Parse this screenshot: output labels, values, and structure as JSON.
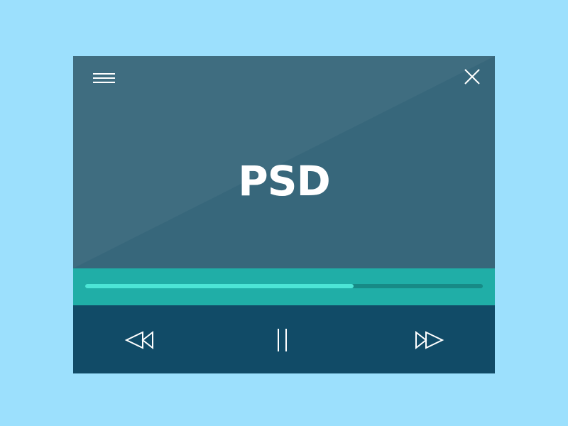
{
  "player": {
    "title": "PSD",
    "progress_fraction": 0.675
  },
  "icons": {
    "menu": "hamburger-menu-icon",
    "close": "close-icon",
    "rewind": "rewind-icon",
    "pause": "pause-icon",
    "fast_forward": "fast-forward-icon"
  },
  "colors": {
    "background": "#9ce0fd",
    "screen": "#37677b",
    "progress_bar": "#20aea7",
    "progress_fill": "#4ce5d6",
    "controls": "#114b67"
  }
}
